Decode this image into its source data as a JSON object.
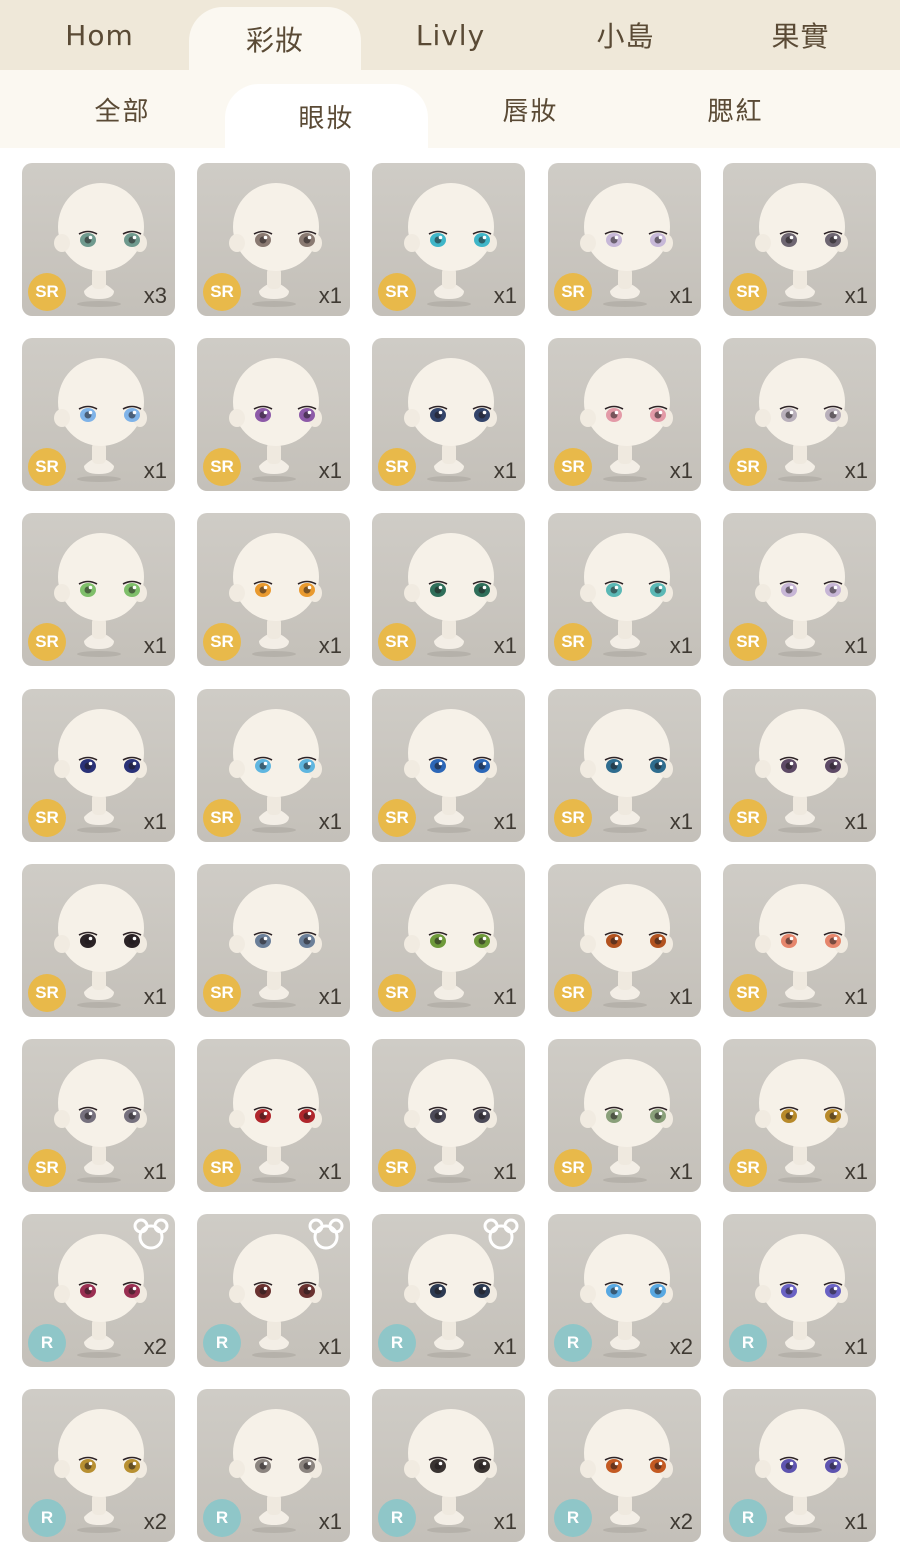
{
  "top_tabs": [
    {
      "label": "Hom",
      "active": false
    },
    {
      "label": "彩妝",
      "active": true
    },
    {
      "label": "Livly",
      "active": false
    },
    {
      "label": "小島",
      "active": false
    },
    {
      "label": "果實",
      "active": false
    }
  ],
  "sub_tabs": [
    {
      "label": "全部",
      "active": false
    },
    {
      "label": "眼妝",
      "active": true
    },
    {
      "label": "唇妝",
      "active": false
    },
    {
      "label": "腮紅",
      "active": false
    }
  ],
  "colors": {
    "sr_badge": "#e8b94a",
    "r_badge": "#8fc6c8",
    "tab_bg": "#efe8d9"
  },
  "items": [
    {
      "rarity": "SR",
      "qty": "x3",
      "eye_color": "#6f9a8e",
      "bear": false
    },
    {
      "rarity": "SR",
      "qty": "x1",
      "eye_color": "#8a7a72",
      "bear": false
    },
    {
      "rarity": "SR",
      "qty": "x1",
      "eye_color": "#3fb6c8",
      "bear": false
    },
    {
      "rarity": "SR",
      "qty": "x1",
      "eye_color": "#c7b8d8",
      "bear": false
    },
    {
      "rarity": "SR",
      "qty": "x1",
      "eye_color": "#6e6672",
      "bear": false
    },
    {
      "rarity": "SR",
      "qty": "x1",
      "eye_color": "#7fb3e8",
      "bear": false
    },
    {
      "rarity": "SR",
      "qty": "x1",
      "eye_color": "#8d5aa8",
      "bear": false
    },
    {
      "rarity": "SR",
      "qty": "x1",
      "eye_color": "#33446a",
      "bear": false
    },
    {
      "rarity": "SR",
      "qty": "x1",
      "eye_color": "#e39aa7",
      "bear": false
    },
    {
      "rarity": "SR",
      "qty": "x1",
      "eye_color": "#b9b0bb",
      "bear": false
    },
    {
      "rarity": "SR",
      "qty": "x1",
      "eye_color": "#7fbf6a",
      "bear": false
    },
    {
      "rarity": "SR",
      "qty": "x1",
      "eye_color": "#e99a2f",
      "bear": false
    },
    {
      "rarity": "SR",
      "qty": "x1",
      "eye_color": "#2f6f5a",
      "bear": false
    },
    {
      "rarity": "SR",
      "qty": "x1",
      "eye_color": "#5ab8b5",
      "bear": false
    },
    {
      "rarity": "SR",
      "qty": "x1",
      "eye_color": "#c7b6d6",
      "bear": false
    },
    {
      "rarity": "SR",
      "qty": "x1",
      "eye_color": "#2a3278",
      "bear": false
    },
    {
      "rarity": "SR",
      "qty": "x1",
      "eye_color": "#5fb6e0",
      "bear": false
    },
    {
      "rarity": "SR",
      "qty": "x1",
      "eye_color": "#2c67b8",
      "bear": false
    },
    {
      "rarity": "SR",
      "qty": "x1",
      "eye_color": "#2f6d8f",
      "bear": false
    },
    {
      "rarity": "SR",
      "qty": "x1",
      "eye_color": "#5e4a66",
      "bear": false
    },
    {
      "rarity": "SR",
      "qty": "x1",
      "eye_color": "#2b2326",
      "bear": false
    },
    {
      "rarity": "SR",
      "qty": "x1",
      "eye_color": "#6b7f99",
      "bear": false
    },
    {
      "rarity": "SR",
      "qty": "x1",
      "eye_color": "#6e9a3a",
      "bear": false
    },
    {
      "rarity": "SR",
      "qty": "x1",
      "eye_color": "#b2521f",
      "bear": false
    },
    {
      "rarity": "SR",
      "qty": "x1",
      "eye_color": "#e6866c",
      "bear": false
    },
    {
      "rarity": "SR",
      "qty": "x1",
      "eye_color": "#76717e",
      "bear": false
    },
    {
      "rarity": "SR",
      "qty": "x1",
      "eye_color": "#b0262c",
      "bear": false
    },
    {
      "rarity": "SR",
      "qty": "x1",
      "eye_color": "#4c4a58",
      "bear": false
    },
    {
      "rarity": "SR",
      "qty": "x1",
      "eye_color": "#8aa07a",
      "bear": false
    },
    {
      "rarity": "SR",
      "qty": "x1",
      "eye_color": "#b88a2a",
      "bear": false
    },
    {
      "rarity": "R",
      "qty": "x2",
      "eye_color": "#9a2f52",
      "bear": true
    },
    {
      "rarity": "R",
      "qty": "x1",
      "eye_color": "#6a3230",
      "bear": true
    },
    {
      "rarity": "R",
      "qty": "x1",
      "eye_color": "#2c3a52",
      "bear": true
    },
    {
      "rarity": "R",
      "qty": "x2",
      "eye_color": "#58a8e2",
      "bear": false
    },
    {
      "rarity": "R",
      "qty": "x1",
      "eye_color": "#6a62c4",
      "bear": false
    },
    {
      "rarity": "R",
      "qty": "x2",
      "eye_color": "#b89032",
      "bear": false
    },
    {
      "rarity": "R",
      "qty": "x1",
      "eye_color": "#8c8580",
      "bear": false
    },
    {
      "rarity": "R",
      "qty": "x1",
      "eye_color": "#3a3432",
      "bear": false
    },
    {
      "rarity": "R",
      "qty": "x2",
      "eye_color": "#c45a22",
      "bear": false
    },
    {
      "rarity": "R",
      "qty": "x1",
      "eye_color": "#5e54b0",
      "bear": false
    }
  ]
}
